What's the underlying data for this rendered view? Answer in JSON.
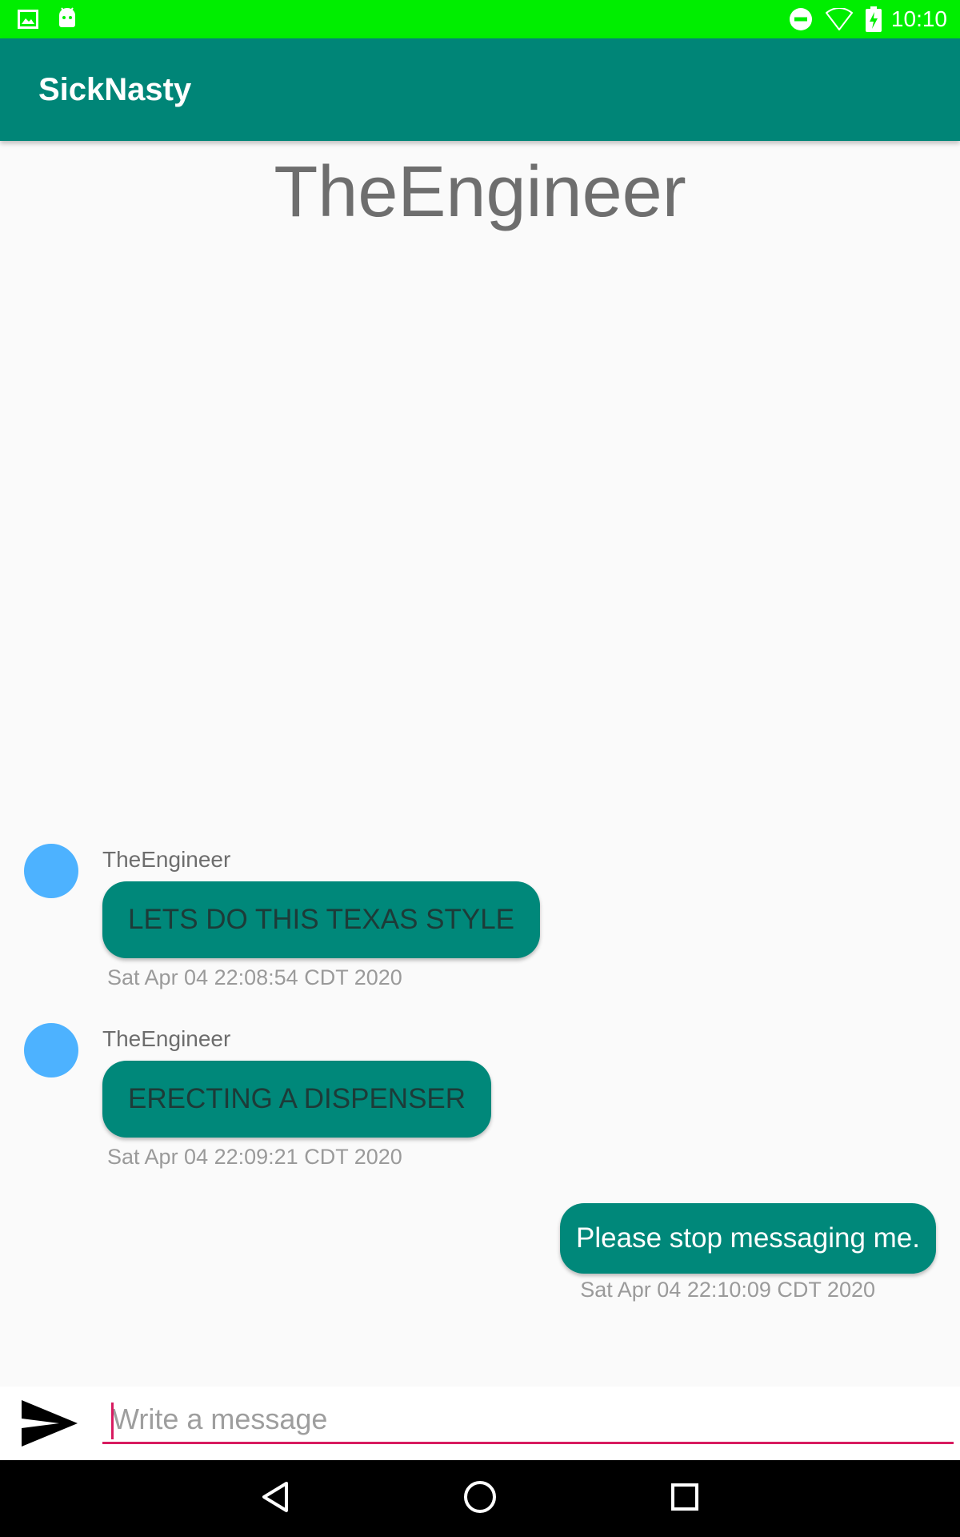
{
  "status_bar": {
    "time": "10:10",
    "icons": [
      "image-icon",
      "android-icon",
      "do-not-disturb-icon",
      "wifi-icon",
      "battery-charging-icon"
    ],
    "background_color": "#00ee00"
  },
  "app_bar": {
    "title": "SickNasty",
    "background_color": "#008577"
  },
  "conversation": {
    "title": "TheEngineer"
  },
  "messages": [
    {
      "direction": "incoming",
      "sender": "TheEngineer",
      "text": "LETS DO THIS TEXAS STYLE",
      "timestamp": "Sat Apr 04 22:08:54 CDT 2020"
    },
    {
      "direction": "incoming",
      "sender": "TheEngineer",
      "text": "ERECTING A DISPENSER",
      "timestamp": "Sat Apr 04 22:09:21 CDT 2020"
    },
    {
      "direction": "outgoing",
      "text": "Please stop messaging me.",
      "timestamp": "Sat Apr 04 22:10:09 CDT 2020"
    }
  ],
  "composer": {
    "placeholder": "Write a message",
    "value": "",
    "send_icon": "send-icon",
    "accent_color": "#d81b60"
  },
  "nav_bar": {
    "buttons": [
      "back-icon",
      "home-icon",
      "recents-icon"
    ]
  },
  "colors": {
    "bubble": "#00887a",
    "avatar": "#4db2ff"
  }
}
